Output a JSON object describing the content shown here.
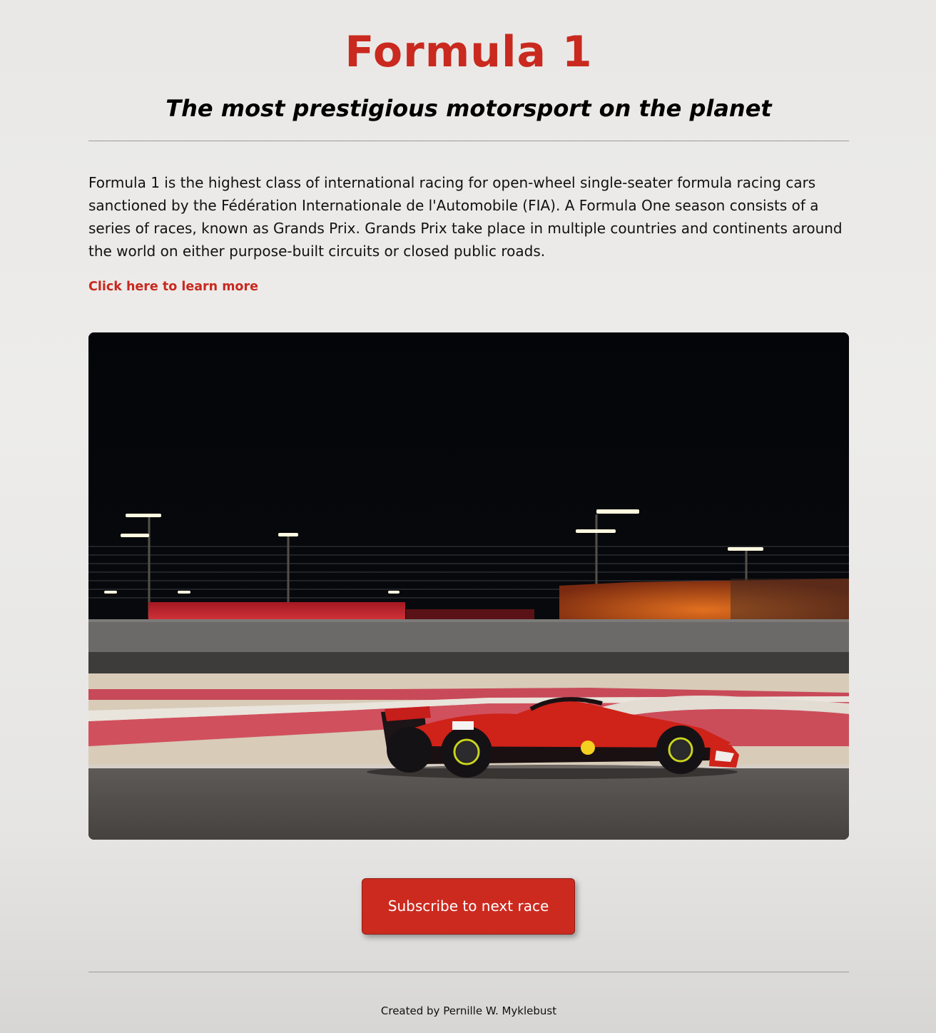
{
  "header": {
    "title": "Formula 1",
    "subtitle": "The most prestigious motorsport on the planet"
  },
  "main": {
    "intro": "Formula 1 is the highest class of international racing for open-wheel single-seater formula racing cars sanctioned by the Fédération Internationale de l'Automobile (FIA). A Formula One season consists of a series of races, known as Grands Prix. Grands Prix take place in multiple countries and continents around the world on either purpose-built circuits or closed public roads.",
    "learn_more_link": "Click here to learn more",
    "subscribe_button": "Subscribe to next race"
  },
  "footer": {
    "credit": "Created by Pernille W. Myklebust"
  },
  "colors": {
    "accent": "#c9291f",
    "background": "#eceae8",
    "text": "#111111"
  },
  "icons": {
    "hero_image": "ferrari-f1-car-night-race-photo"
  }
}
